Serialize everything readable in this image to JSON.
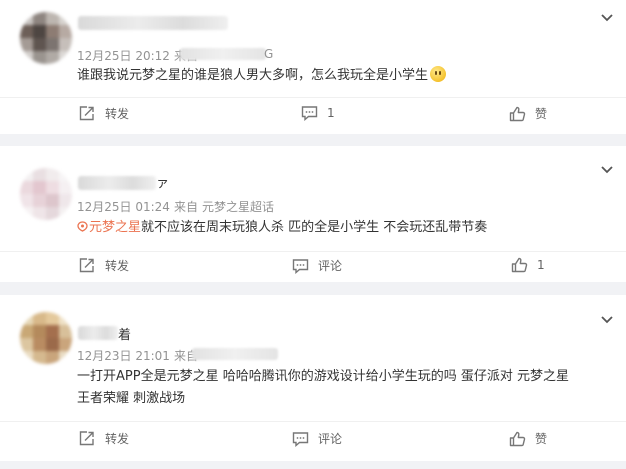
{
  "comments": [
    {
      "date": "12月25日 20:12",
      "source_prefix": "来自",
      "source_tail": "G",
      "text": "谁跟我说元梦之星的谁是狼人男大多啊，怎么我玩全是小学生",
      "actions": {
        "repost": "转发",
        "comment": "1",
        "like": "赞"
      }
    },
    {
      "name_tail": "ァ",
      "date": "12月25日 01:24",
      "source_prefix": "来自",
      "source": "元梦之星超话",
      "tag": "元梦之星",
      "text": "就不应该在周末玩狼人杀 匹的全是小学生 不会玩还乱带节奏",
      "actions": {
        "repost": "转发",
        "comment": "评论",
        "like": "1"
      }
    },
    {
      "name_tail": "着",
      "date": "12月23日 21:01",
      "source_prefix": "来自",
      "text_line1": "一打开APP全是元梦之星 哈哈哈腾讯你的游戏设计给小学生玩的吗 蛋仔派对 元梦之星",
      "text_line2": "王者荣耀 刺激战场",
      "actions": {
        "repost": "转发",
        "comment": "评论",
        "like": "赞"
      }
    }
  ],
  "colors": {
    "accent": "#eb7350",
    "meta": "#939393",
    "text": "#333333",
    "background": "#f1f2f5"
  },
  "icons": [
    "chevron-down-icon",
    "repost-icon",
    "comment-icon",
    "like-icon",
    "supertopic-icon",
    "smile-emoji-icon"
  ]
}
